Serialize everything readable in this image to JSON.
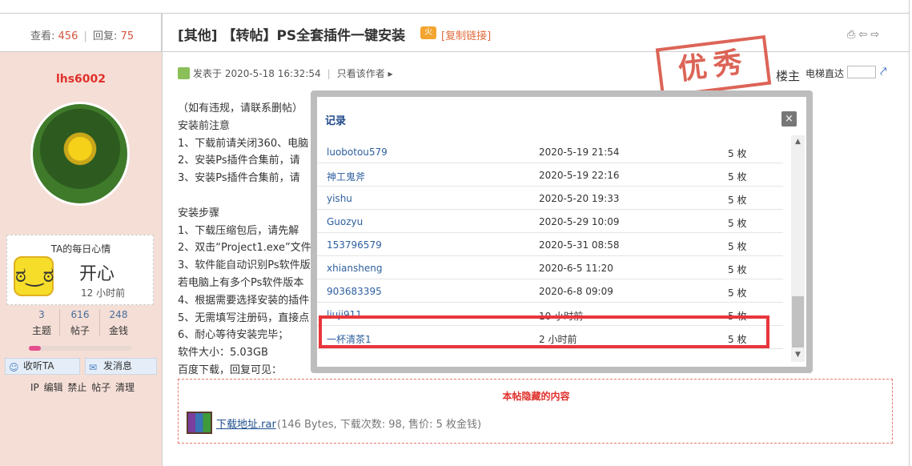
{
  "stats": {
    "views_label": "查看:",
    "views": "456",
    "replies_label": "回复:",
    "replies": "75"
  },
  "thread": {
    "title": "[其他] 【转帖】PS全套插件一键安装",
    "title_icon": "火",
    "copy_link": "[复制链接]",
    "header_icons": "⎙⇦⇨"
  },
  "user": {
    "name": "lhs6002",
    "mood_title": "TA的每日心情",
    "mood_face": "ಠ‿ಠ",
    "mood": "开心",
    "mood_time": "12 小时前",
    "stats": [
      {
        "value": "3",
        "label": "主题"
      },
      {
        "value": "616",
        "label": "帖子"
      },
      {
        "value": "248",
        "label": "金钱"
      }
    ],
    "progress_fraction": 0.12,
    "follow_label": "收听TA",
    "message_label": "发消息",
    "admin_links": "IP 编辑 禁止 帖子 清理"
  },
  "post": {
    "posted_at": "发表于 2020-5-18 16:32:54",
    "only_author": "只看该作者",
    "stamp": "优秀",
    "floor": "楼主",
    "jump_label": "电梯直达",
    "lines": [
      "（如有违规，请联系删帖）",
      "安装前注意",
      "1、下载前请关闭360、电脑",
      "2、安装Ps插件合集前，请",
      "3、安装Ps插件合集前，请",
      "",
      "安装步骤",
      "1、下载压缩包后，请先解",
      "2、双击“Project1.exe”文件",
      "3、软件能自动识别Ps软件版",
      "  若电脑上有多个Ps软件版本",
      "4、根据需要选择安装的插件",
      "5、无需填写注册码，直接点",
      "6、耐心等待安装完毕；",
      "软件大小：5.03GB",
      "百度下载，回复可见："
    ],
    "hidden_title": "本帖隐藏的内容",
    "download_link": "下载地址.rar",
    "download_info": "(146 Bytes, 下载次数: 98, 售价: 5 枚金钱)"
  },
  "modal": {
    "title": "记录",
    "close": "×",
    "rows": [
      {
        "user": "luobotou579",
        "time": "2020-5-19 21:54",
        "count": "5 枚"
      },
      {
        "user": "神工鬼斧",
        "time": "2020-5-19 22:16",
        "count": "5 枚"
      },
      {
        "user": "yishu",
        "time": "2020-5-20 19:33",
        "count": "5 枚"
      },
      {
        "user": "Guozyu",
        "time": "2020-5-29 10:09",
        "count": "5 枚"
      },
      {
        "user": "153796579",
        "time": "2020-5-31 08:58",
        "count": "5 枚"
      },
      {
        "user": "xhiansheng",
        "time": "2020-6-5 11:20",
        "count": "5 枚"
      },
      {
        "user": "903683395",
        "time": "2020-6-8 09:09",
        "count": "5 枚"
      },
      {
        "user": "liuji911",
        "time": "10 小时前",
        "count": "5 枚"
      },
      {
        "user": "一杯清茶1",
        "time": "2 小时前",
        "count": "5 枚"
      }
    ]
  },
  "colors": {
    "accent_red": "#e0302a",
    "link_blue": "#2d5f9e",
    "sidebar_bg": "#f4ded6",
    "highlight": "#e8363b"
  }
}
